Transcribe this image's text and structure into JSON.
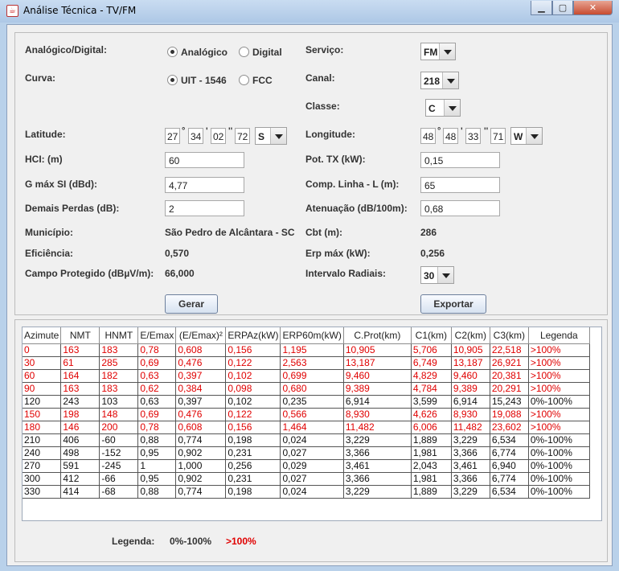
{
  "window": {
    "title": "Análise Técnica - TV/FM",
    "icon": "java-cup-icon"
  },
  "form": {
    "analog_digital_label": "Analógico/Digital:",
    "analog_option": "Analógico",
    "digital_option": "Digital",
    "curve_label": "Curva:",
    "uit_option": "UIT - 1546",
    "fcc_option": "FCC",
    "latitude_label": "Latitude:",
    "lat_deg": "27",
    "lat_min": "34",
    "lat_sec": "02",
    "lat_dec": "72",
    "lat_hemi": "S",
    "hci_label": "HCI: (m)",
    "hci_value": "60",
    "gmax_label": "G máx SI (dBd):",
    "gmax_value": "4,77",
    "losses_label": "Demais Perdas (dB):",
    "losses_value": "2",
    "municipio_label": "Município:",
    "municipio_value": "São Pedro de Alcântara - SC",
    "eficiencia_label": "Eficiência:",
    "eficiencia_value": "0,570",
    "campo_label": "Campo Protegido (dBµV/m):",
    "campo_value": "66,000",
    "servico_label": "Serviço:",
    "servico_value": "FM",
    "canal_label": "Canal:",
    "canal_value": "218",
    "classe_label": "Classe:",
    "classe_value": "C",
    "longitude_label": "Longitude:",
    "lon_deg": "48",
    "lon_min": "48",
    "lon_sec": "33",
    "lon_dec": "71",
    "lon_hemi": "W",
    "pot_label": "Pot. TX (kW):",
    "pot_value": "0,15",
    "comp_label": "Comp. Linha - L (m):",
    "comp_value": "65",
    "aten_label": "Atenuação (dB/100m):",
    "aten_value": "0,68",
    "cbt_label": "Cbt (m):",
    "cbt_value": "286",
    "erp_label": "Erp máx (kW):",
    "erp_value": "0,256",
    "radiais_label": "Intervalo Radiais:",
    "radiais_value": "30",
    "gerar_label": "Gerar",
    "exportar_label": "Exportar"
  },
  "table": {
    "headers": [
      "Azimute",
      "NMT",
      "HNMT",
      "E/Emax",
      "(E/Emax)²",
      "ERPAz(kW)",
      "ERP60m(kW)",
      "C.Prot(km)",
      "C1(km)",
      "C2(km)",
      "C3(km)",
      "Legenda"
    ],
    "rows": [
      {
        "red": true,
        "cells": [
          "0",
          "163",
          "183",
          "0,78",
          "0,608",
          "0,156",
          "1,195",
          "10,905",
          "5,706",
          "10,905",
          "22,518",
          ">100%"
        ]
      },
      {
        "red": true,
        "cells": [
          "30",
          "61",
          "285",
          "0,69",
          "0,476",
          "0,122",
          "2,563",
          "13,187",
          "6,749",
          "13,187",
          "26,921",
          ">100%"
        ]
      },
      {
        "red": true,
        "cells": [
          "60",
          "164",
          "182",
          "0,63",
          "0,397",
          "0,102",
          "0,699",
          "9,460",
          "4,829",
          "9,460",
          "20,381",
          ">100%"
        ]
      },
      {
        "red": true,
        "cells": [
          "90",
          "163",
          "183",
          "0,62",
          "0,384",
          "0,098",
          "0,680",
          "9,389",
          "4,784",
          "9,389",
          "20,291",
          ">100%"
        ]
      },
      {
        "red": false,
        "cells": [
          "120",
          "243",
          "103",
          "0,63",
          "0,397",
          "0,102",
          "0,235",
          "6,914",
          "3,599",
          "6,914",
          "15,243",
          "0%-100%"
        ]
      },
      {
        "red": true,
        "cells": [
          "150",
          "198",
          "148",
          "0,69",
          "0,476",
          "0,122",
          "0,566",
          "8,930",
          "4,626",
          "8,930",
          "19,088",
          ">100%"
        ]
      },
      {
        "red": true,
        "cells": [
          "180",
          "146",
          "200",
          "0,78",
          "0,608",
          "0,156",
          "1,464",
          "11,482",
          "6,006",
          "11,482",
          "23,602",
          ">100%"
        ]
      },
      {
        "red": false,
        "cells": [
          "210",
          "406",
          "-60",
          "0,88",
          "0,774",
          "0,198",
          "0,024",
          "3,229",
          "1,889",
          "3,229",
          "6,534",
          "0%-100%"
        ]
      },
      {
        "red": false,
        "cells": [
          "240",
          "498",
          "-152",
          "0,95",
          "0,902",
          "0,231",
          "0,027",
          "3,366",
          "1,981",
          "3,366",
          "6,774",
          "0%-100%"
        ]
      },
      {
        "red": false,
        "cells": [
          "270",
          "591",
          "-245",
          "1",
          "1,000",
          "0,256",
          "0,029",
          "3,461",
          "2,043",
          "3,461",
          "6,940",
          "0%-100%"
        ]
      },
      {
        "red": false,
        "cells": [
          "300",
          "412",
          "-66",
          "0,95",
          "0,902",
          "0,231",
          "0,027",
          "3,366",
          "1,981",
          "3,366",
          "6,774",
          "0%-100%"
        ]
      },
      {
        "red": false,
        "cells": [
          "330",
          "414",
          "-68",
          "0,88",
          "0,774",
          "0,198",
          "0,024",
          "3,229",
          "1,889",
          "3,229",
          "6,534",
          "0%-100%"
        ]
      }
    ]
  },
  "legend": {
    "label": "Legenda:",
    "normal": "0%-100%",
    "over": ">100%",
    "over_color": "#e00000"
  }
}
